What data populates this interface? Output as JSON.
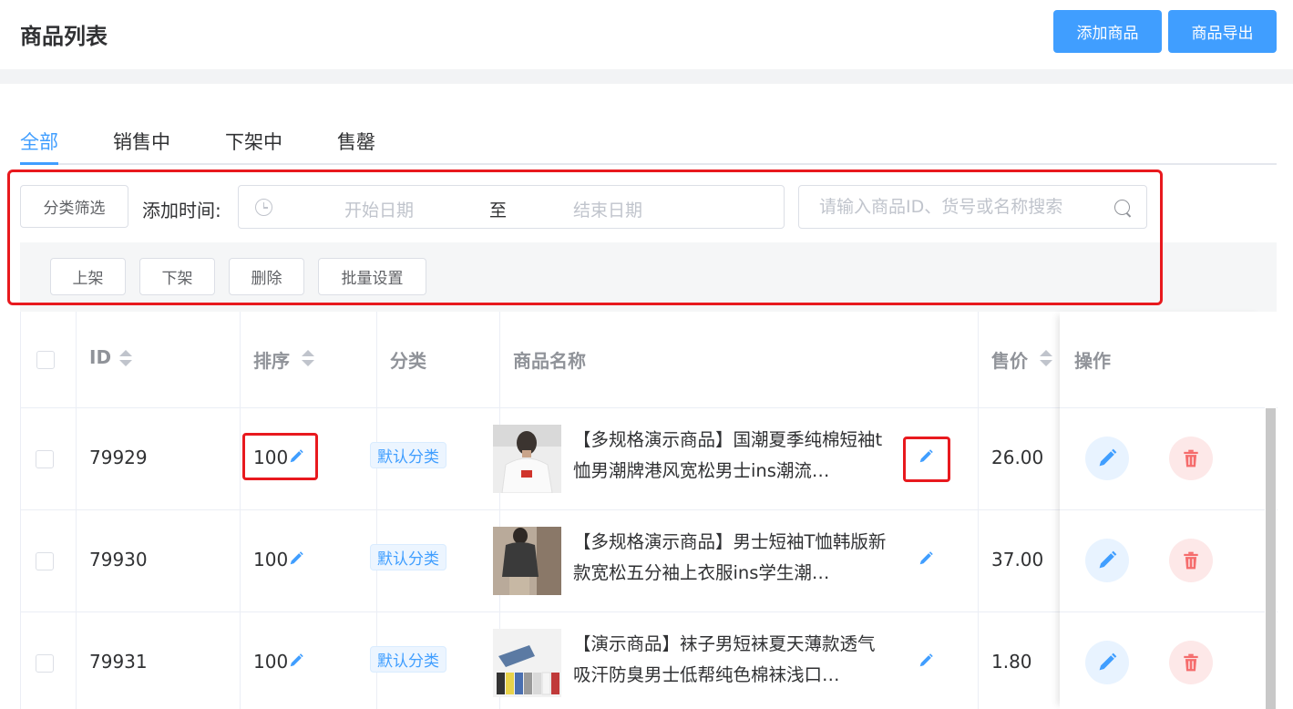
{
  "header": {
    "title": "商品列表",
    "add_label": "添加商品",
    "export_label": "商品导出"
  },
  "tabs": [
    {
      "label": "全部",
      "active": true
    },
    {
      "label": "销售中",
      "active": false
    },
    {
      "label": "下架中",
      "active": false
    },
    {
      "label": "售罄",
      "active": false
    }
  ],
  "filter": {
    "category_label": "分类筛选",
    "time_label": "添加时间:",
    "start_placeholder": "开始日期",
    "range_separator": "至",
    "end_placeholder": "结束日期",
    "search_placeholder": "请输入商品ID、货号或名称搜索"
  },
  "batch": {
    "on_shelf": "上架",
    "off_shelf": "下架",
    "delete": "删除",
    "batch_set": "批量设置"
  },
  "table": {
    "headers": {
      "id": "ID",
      "sort": "排序",
      "category": "分类",
      "name": "商品名称",
      "price": "售价",
      "actions": "操作"
    },
    "rows": [
      {
        "id": "79929",
        "sort": "100",
        "category": "默认分类",
        "name": "【多规格演示商品】国潮夏季纯棉短袖t恤男潮牌港风宽松男士ins潮流…",
        "price": "26.00"
      },
      {
        "id": "79930",
        "sort": "100",
        "category": "默认分类",
        "name": "【多规格演示商品】男士短袖T恤韩版新款宽松五分袖上衣服ins学生潮…",
        "price": "37.00"
      },
      {
        "id": "79931",
        "sort": "100",
        "category": "默认分类",
        "name": "【演示商品】袜子男短袜夏天薄款透气吸汗防臭男士低帮纯色棉袜浅口…",
        "price": "1.80"
      }
    ]
  },
  "colors": {
    "primary": "#409eff",
    "highlight": "#e8191e",
    "danger": "#f56c6c"
  }
}
